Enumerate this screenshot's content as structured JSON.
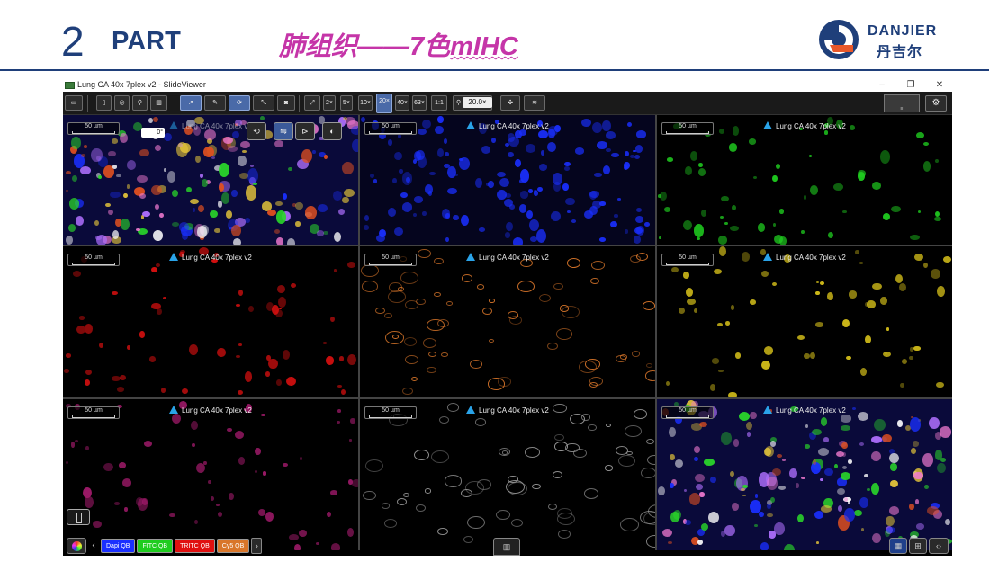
{
  "slide": {
    "part_number": "2",
    "part_word": "PART",
    "title_main": "肺组织——7色",
    "title_emph": "mIHC",
    "logo_latin": "DANJIER",
    "logo_cn": "丹吉尔",
    "brand_color": "#1f3f7a",
    "title_color": "#c535a8"
  },
  "window": {
    "title": "Lung CA  40x 7plex v2 - SlideViewer",
    "controls": {
      "minimize": "–",
      "restore": "❐",
      "close": "✕"
    }
  },
  "toolbar": {
    "zoom_levels": [
      "2×",
      "5×",
      "10×",
      "20×",
      "40×",
      "63×",
      "1:1"
    ],
    "zoom_value": "20.0×",
    "active_zoom": "20×",
    "rotation_value": "0°"
  },
  "panels": [
    {
      "scale": "50 µm",
      "label": "Lung CA  40x 7plex v2",
      "channel": "composite",
      "color": "#c060ff"
    },
    {
      "scale": "50 µm",
      "label": "Lung CA  40x 7plex v2",
      "channel": "dapi",
      "color": "#1a2fff"
    },
    {
      "scale": "50 µm",
      "label": "Lung CA  40x 7plex v2",
      "channel": "fitc",
      "color": "#1fcc1f"
    },
    {
      "scale": "50 µm",
      "label": "Lung CA  40x 7plex v2",
      "channel": "tritc",
      "color": "#e01010"
    },
    {
      "scale": "50 µm",
      "label": "Lung CA  40x 7plex v2",
      "channel": "cy5",
      "color": "#d9762a"
    },
    {
      "scale": "50 µm",
      "label": "Lung CA  40x 7plex v2",
      "channel": "yellow",
      "color": "#d8c21a"
    },
    {
      "scale": "50 µm",
      "label": "Lung CA  40x 7plex v2",
      "channel": "magenta",
      "color": "#a01a6a"
    },
    {
      "scale": "50 µm",
      "label": "Lung CA  40x 7plex v2",
      "channel": "gray",
      "color": "#9a9a9a"
    },
    {
      "scale": "50 µm",
      "label": "Lung CA  40x 7plex v2",
      "channel": "composite",
      "color": "#c060ff"
    }
  ],
  "channels": [
    {
      "label": "Dapi QB",
      "color": "#1a2fff"
    },
    {
      "label": "FITC QB",
      "color": "#1fcc1f"
    },
    {
      "label": "TRITC QB",
      "color": "#e01010"
    },
    {
      "label": "Cy5 QB",
      "color": "#d9762a"
    }
  ]
}
